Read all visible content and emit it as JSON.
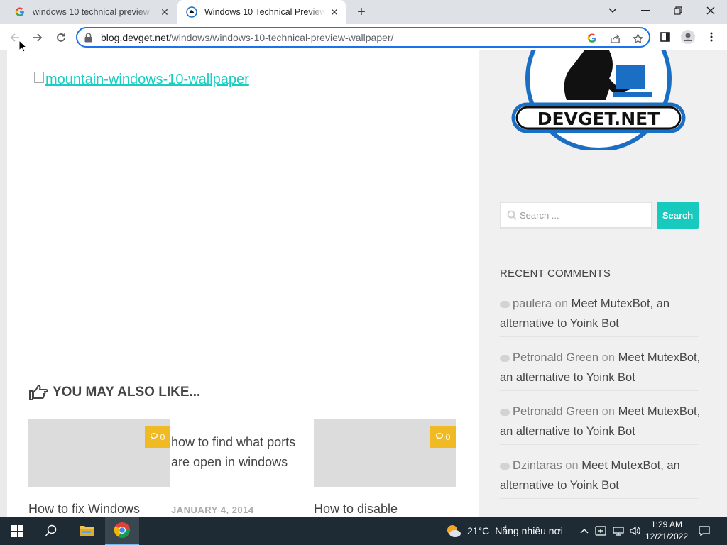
{
  "browser": {
    "tabs": [
      {
        "title": "windows 10 technical preview wa",
        "favicon": "google-g-icon",
        "active": false
      },
      {
        "title": "Windows 10 Technical Preview W",
        "favicon": "devget-icon",
        "active": true
      }
    ],
    "address": {
      "host": "blog.devget.net",
      "path": "/windows/windows-10-technical-preview-wallpaper/"
    }
  },
  "content": {
    "image_alt": "mountain-windows-10-wallpaper",
    "you_may_also_like": "YOU MAY ALSO LIKE...",
    "related": [
      {
        "title": "How to fix Windows",
        "comments": "0",
        "has_image": true
      },
      {
        "title": "how to find what ports are open in windows",
        "date": "JANUARY 4, 2014",
        "has_image": false
      },
      {
        "title": "How to disable",
        "comments": "0",
        "has_image": true
      }
    ]
  },
  "sidebar": {
    "logo_text": "DEVGET.NET",
    "search": {
      "placeholder": "Search ...",
      "button": "Search"
    },
    "recent_comments_title": "RECENT COMMENTS",
    "comments": [
      {
        "author": "paulera",
        "on": "on",
        "post": "Meet MutexBot, an alternative to Yoink Bot"
      },
      {
        "author": "Petronald Green",
        "on": "on",
        "post": "Meet MutexBot, an alternative to Yoink Bot"
      },
      {
        "author": "Petronald Green",
        "on": "on",
        "post": "Meet MutexBot, an alternative to Yoink Bot"
      },
      {
        "author": "Dzintaras",
        "on": "on",
        "post": "Meet MutexBot, an alternative to Yoink Bot"
      }
    ]
  },
  "taskbar": {
    "weather": {
      "temp": "21°C",
      "desc": "Nắng nhiều nơi"
    },
    "time": "1:29 AM",
    "date": "12/21/2022"
  },
  "colors": {
    "accent": "#16cfc1",
    "badge": "#f0ba24",
    "chrome_blue": "#1a73e8"
  }
}
